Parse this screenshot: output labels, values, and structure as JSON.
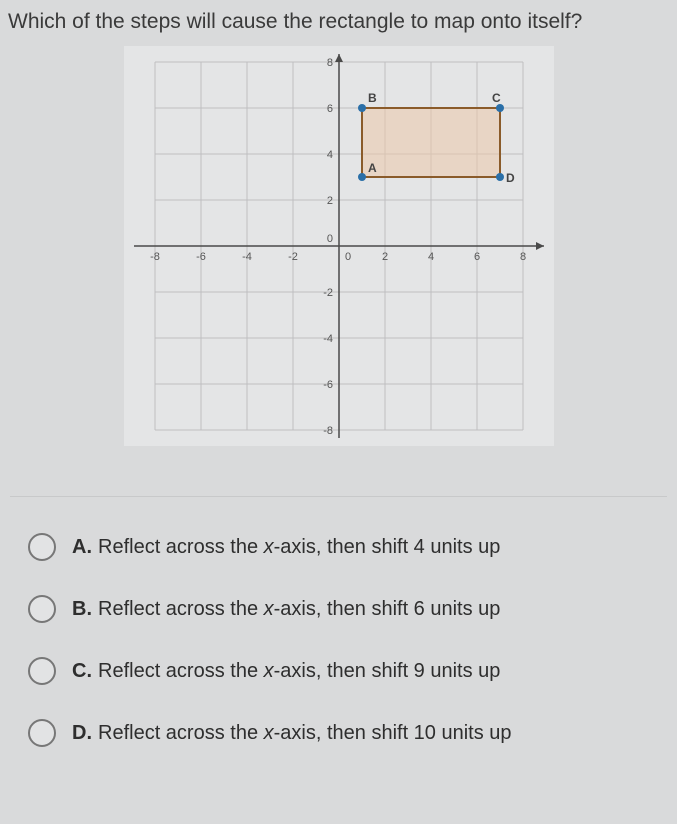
{
  "question": "Which of the steps will cause the rectangle to map onto itself?",
  "chart_data": {
    "type": "scatter",
    "title": "",
    "xlabel": "",
    "ylabel": "",
    "xlim": [
      -8,
      8
    ],
    "ylim": [
      -8,
      8
    ],
    "xticks": [
      -8,
      -6,
      -4,
      -2,
      0,
      2,
      4,
      6,
      8
    ],
    "yticks": [
      -8,
      -6,
      -4,
      -2,
      0,
      2,
      4,
      6,
      8
    ],
    "points": [
      {
        "name": "A",
        "x": 1,
        "y": 3
      },
      {
        "name": "B",
        "x": 1,
        "y": 6
      },
      {
        "name": "C",
        "x": 7,
        "y": 6
      },
      {
        "name": "D",
        "x": 7,
        "y": 3
      }
    ],
    "shape": "rectangle ABCD with A(1,3), B(1,6), C(7,6), D(7,3)"
  },
  "options": {
    "A": {
      "letter": "A.",
      "text_pre": "Reflect across the ",
      "axis": "x",
      "text_post": "-axis, then shift 4 units up"
    },
    "B": {
      "letter": "B.",
      "text_pre": "Reflect across the ",
      "axis": "x",
      "text_post": "-axis, then shift 6 units up"
    },
    "C": {
      "letter": "C.",
      "text_pre": "Reflect across the ",
      "axis": "x",
      "text_post": "-axis, then shift 9 units up"
    },
    "D": {
      "letter": "D.",
      "text_pre": "Reflect across the ",
      "axis": "x",
      "text_post": "-axis, then shift 10 units up"
    }
  }
}
